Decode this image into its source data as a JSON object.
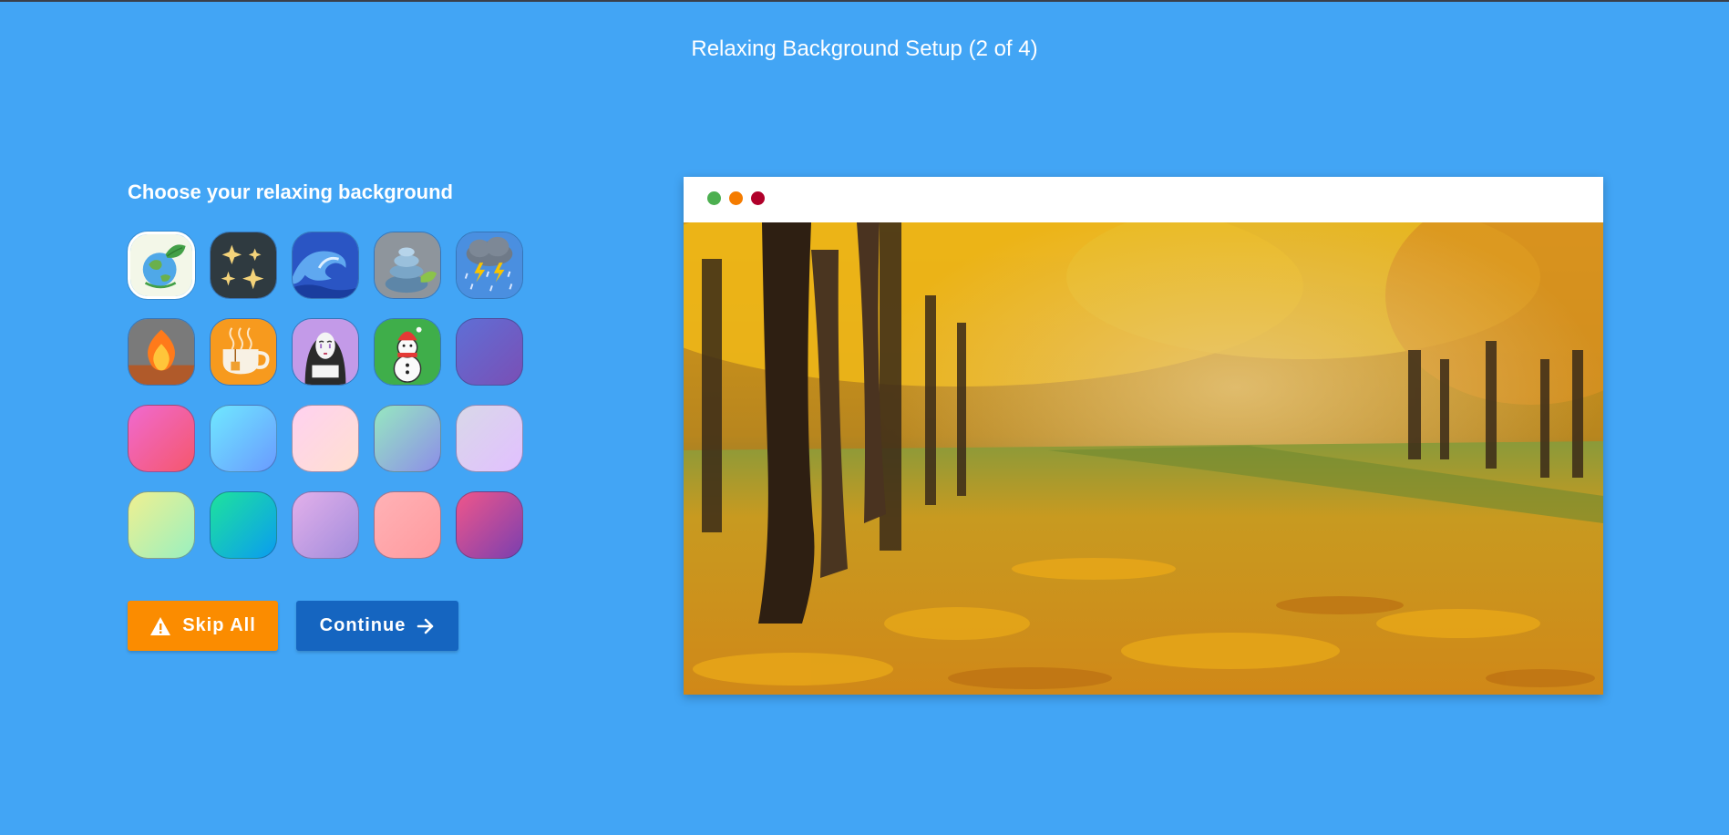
{
  "header": {
    "title": "Relaxing Background Setup (2 of 4)"
  },
  "picker": {
    "heading": "Choose your relaxing background",
    "tiles": [
      {
        "name": "earth-leaf-icon",
        "selected": true
      },
      {
        "name": "sparkles-icon"
      },
      {
        "name": "wave-icon"
      },
      {
        "name": "stones-icon"
      },
      {
        "name": "storm-cloud-icon"
      },
      {
        "name": "campfire-icon"
      },
      {
        "name": "tea-cup-icon"
      },
      {
        "name": "spirit-mask-icon"
      },
      {
        "name": "snowman-icon"
      },
      {
        "name": "gradient",
        "colors": [
          "#5f6fd6",
          "#7a4fb5"
        ]
      },
      {
        "name": "gradient",
        "colors": [
          "#f06ad0",
          "#f5576c"
        ]
      },
      {
        "name": "gradient",
        "colors": [
          "#6fe8ff",
          "#6a9bff"
        ]
      },
      {
        "name": "gradient",
        "colors": [
          "#ffd1f0",
          "#ffe0d0"
        ]
      },
      {
        "name": "gradient",
        "colors": [
          "#96e8c0",
          "#8d8ee8"
        ]
      },
      {
        "name": "gradient",
        "colors": [
          "#d8d8e8",
          "#e2c0ff"
        ]
      },
      {
        "name": "gradient",
        "colors": [
          "#f0f090",
          "#99f0c0"
        ]
      },
      {
        "name": "gradient",
        "colors": [
          "#1ee39c",
          "#0a9cf0"
        ]
      },
      {
        "name": "gradient",
        "colors": [
          "#e3b0ea",
          "#a18cdc"
        ]
      },
      {
        "name": "gradient",
        "colors": [
          "#ffb2b6",
          "#ff9a9e"
        ]
      },
      {
        "name": "gradient",
        "colors": [
          "#f0568a",
          "#7a3fb0"
        ]
      }
    ]
  },
  "buttons": {
    "skip_label": "Skip All",
    "continue_label": "Continue"
  },
  "preview": {
    "window_dots": [
      "#4caf50",
      "#f57c00",
      "#b0002a"
    ]
  },
  "colors": {
    "background": "#42a5f5",
    "skip": "#fb8c00",
    "continue": "#1565c0"
  }
}
